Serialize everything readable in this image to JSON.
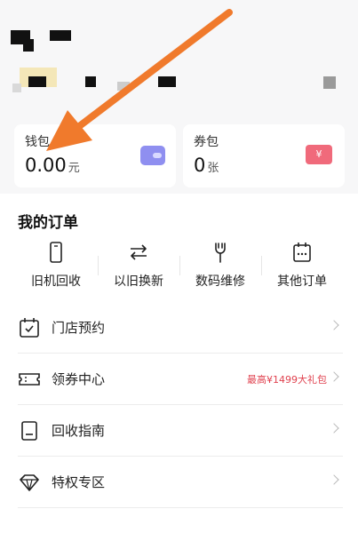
{
  "wallet": {
    "title": "钱包",
    "amount": "0.00",
    "unit": "元"
  },
  "coupon": {
    "title": "券包",
    "amount": "0",
    "unit": "张",
    "icon_label": "¥"
  },
  "orders": {
    "title": "我的订单",
    "items": [
      {
        "label": "旧机回收",
        "icon": "phone-icon"
      },
      {
        "label": "以旧换新",
        "icon": "exchange-icon"
      },
      {
        "label": "数码维修",
        "icon": "wrench-icon"
      },
      {
        "label": "其他订单",
        "icon": "calendar-icon"
      }
    ]
  },
  "menu": [
    {
      "label": "门店预约",
      "icon": "calendar-check-icon",
      "extra": ""
    },
    {
      "label": "领券中心",
      "icon": "ticket-icon",
      "extra": "最高¥1499大礼包"
    },
    {
      "label": "回收指南",
      "icon": "guide-icon",
      "extra": ""
    },
    {
      "label": "特权专区",
      "icon": "diamond-icon",
      "extra": ""
    }
  ],
  "colors": {
    "accent_red": "#e0424f",
    "arrow": "#f07a2c",
    "wallet_icon": "#8f8ff0",
    "coupon_icon": "#f06a7b"
  }
}
